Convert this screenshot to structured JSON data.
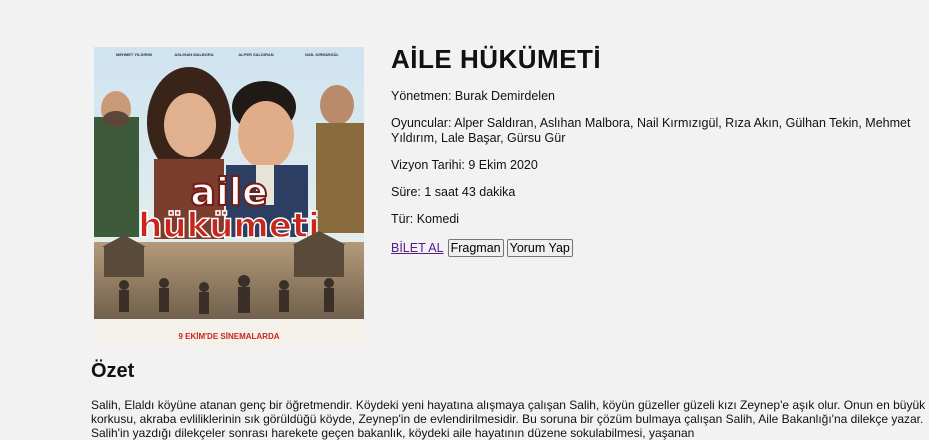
{
  "movie": {
    "title": "AİLE HÜKÜMETİ",
    "director_line": "Yönetmen: Burak Demirdelen",
    "cast_line": "Oyuncular: Alper Saldıran, Aslıhan Malbora, Nail Kırmızıgül, Rıza Akın, Gülhan Tekin, Mehmet Yıldırım, Lale Başar, Gürsu Gür",
    "release_line": "Vizyon Tarihi: 9 Ekim 2020",
    "duration_line": "Süre: 1 saat 43 dakika",
    "genre_line": "Tür: Komedi"
  },
  "actions": {
    "ticket_link": "BİLET AL",
    "trailer_button": "Fragman",
    "comment_button": "Yorum Yap"
  },
  "poster": {
    "names": [
      "MEHMET YILDIRIM",
      "ASLIHAN MALBORA",
      "ALPER SALDIRAN",
      "NAİL KIRMIZIGÜL"
    ],
    "logo_line1": "aile",
    "logo_line2": "hükümeti",
    "release_banner": "9 EKİM'DE SİNEMALARDA"
  },
  "summary": {
    "heading": "Özet",
    "text": "Salih, Elaldı köyüne atanan genç bir öğretmendir. Köydeki yeni hayatına alışmaya çalışan Salih, köyün güzeller güzeli kızı Zeynep'e aşık olur. Onun en büyük korkusu, akraba evliliklerinin sık görüldüğü köyde, Zeynep'in de evlendirilmesidir. Bu soruna bir çözüm bulmaya çalışan Salih, Aile Bakanlığı'na dilekçe yazar. Salih'in yazdığı dilekçeler sonrası harekete geçen bakanlık, köydeki aile hayatının düzene sokulabilmesi, yaşanan"
  },
  "colors": {
    "background": "#f2f2f2",
    "link": "#551a8b",
    "logo_red": "#c8261d"
  }
}
